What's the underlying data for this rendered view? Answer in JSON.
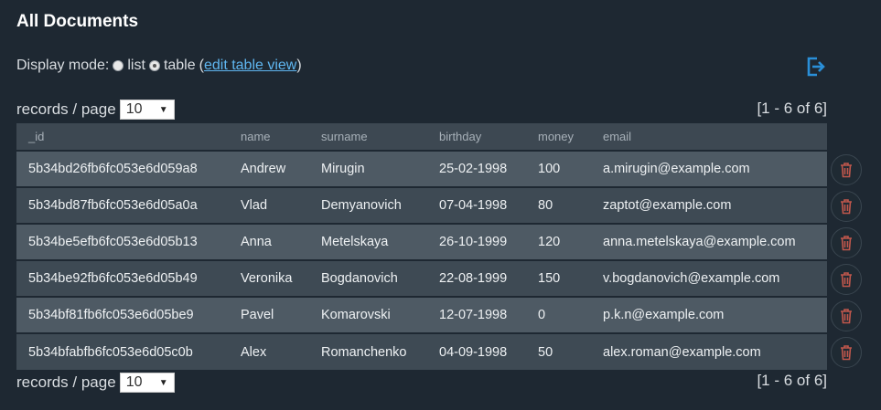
{
  "page_title": "All Documents",
  "display_mode": {
    "label": "Display mode:",
    "option_list": "list",
    "option_table": "table",
    "open_paren": "(",
    "edit_link": "edit table view",
    "close_paren": ")",
    "selected": "table"
  },
  "pagination": {
    "records_label": "records / page",
    "per_page": "10",
    "range_text": "[1 - 6 of 6]"
  },
  "table": {
    "columns": [
      "_id",
      "name",
      "surname",
      "birthday",
      "money",
      "email"
    ],
    "rows": [
      {
        "id": "5b34bd26fb6fc053e6d059a8",
        "name": "Andrew",
        "surname": "Mirugin",
        "birthday": "25-02-1998",
        "money": "100",
        "email": "a.mirugin@example.com"
      },
      {
        "id": "5b34bd87fb6fc053e6d05a0a",
        "name": "Vlad",
        "surname": "Demyanovich",
        "birthday": "07-04-1998",
        "money": "80",
        "email": "zaptot@example.com"
      },
      {
        "id": "5b34be5efb6fc053e6d05b13",
        "name": "Anna",
        "surname": "Metelskaya",
        "birthday": "26-10-1999",
        "money": "120",
        "email": "anna.metelskaya@example.com"
      },
      {
        "id": "5b34be92fb6fc053e6d05b49",
        "name": "Veronika",
        "surname": "Bogdanovich",
        "birthday": "22-08-1999",
        "money": "150",
        "email": "v.bogdanovich@example.com"
      },
      {
        "id": "5b34bf81fb6fc053e6d05be9",
        "name": "Pavel",
        "surname": "Komarovski",
        "birthday": "12-07-1998",
        "money": "0",
        "email": "p.k.n@example.com"
      },
      {
        "id": "5b34bfabfb6fc053e6d05c0b",
        "name": "Alex",
        "surname": "Romanchenko",
        "birthday": "04-09-1998",
        "money": "50",
        "email": "alex.roman@example.com"
      }
    ]
  },
  "icons": {
    "export": "export-icon",
    "delete": "trash-icon"
  },
  "colors": {
    "background": "#1e2832",
    "link": "#5fb6f0",
    "export_icon": "#2a8fd8",
    "delete_icon": "#c0574c"
  }
}
